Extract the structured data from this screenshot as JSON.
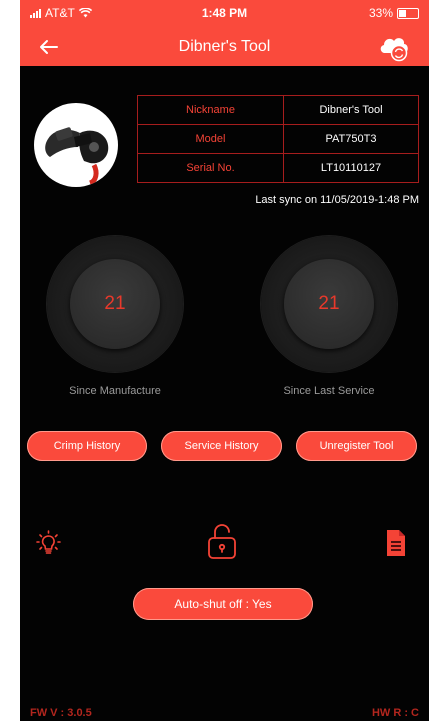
{
  "status_bar": {
    "carrier": "AT&T",
    "time": "1:48 PM",
    "battery": "33%"
  },
  "nav": {
    "title": "Dibner's Tool",
    "back_icon": "arrow-left-icon",
    "action_icon": "cloud-sync-icon"
  },
  "device_info": [
    {
      "key": "Nickname",
      "value": "Dibner's Tool"
    },
    {
      "key": "Model",
      "value": "PAT750T3"
    },
    {
      "key": "Serial No.",
      "value": "LT10110127"
    }
  ],
  "last_sync": "Last sync on 11/05/2019-1:48 PM",
  "counters": [
    {
      "value": "21",
      "label": "Since Manufacture"
    },
    {
      "value": "21",
      "label": "Since Last Service"
    }
  ],
  "buttons": {
    "crimp_history": "Crimp History",
    "service_history": "Service History",
    "unregister_tool": "Unregister Tool",
    "auto_shut_off": "Auto-shut off : Yes"
  },
  "tool_icons": [
    "lightbulb-icon",
    "unlock-icon",
    "document-icon"
  ],
  "footer": {
    "fw_version": "FW V : 3.0.5",
    "hw_revision": "HW R : C"
  },
  "colors": {
    "accent": "#fa4a3c",
    "border": "#a61d1d",
    "background": "#030303"
  }
}
